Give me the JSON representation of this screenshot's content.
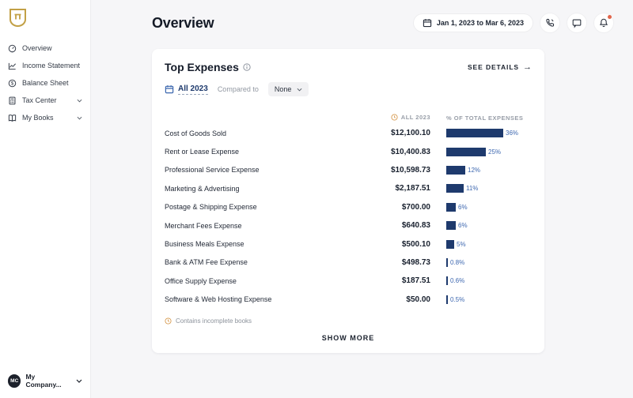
{
  "sidebar": {
    "items": [
      {
        "label": "Overview",
        "icon": "gauge-icon",
        "expandable": false
      },
      {
        "label": "Income Statement",
        "icon": "line-chart-icon",
        "expandable": false
      },
      {
        "label": "Balance Sheet",
        "icon": "dollar-circle-icon",
        "expandable": false
      },
      {
        "label": "Tax Center",
        "icon": "calculator-icon",
        "expandable": true
      },
      {
        "label": "My Books",
        "icon": "book-icon",
        "expandable": true
      }
    ],
    "company": {
      "initials": "MC",
      "name": "My Company..."
    }
  },
  "header": {
    "title": "Overview",
    "date_range": "Jan 1, 2023 to Mar 6, 2023"
  },
  "card": {
    "title": "Top Expenses",
    "see_details_label": "SEE DETAILS",
    "see_details_arrow": "→",
    "period_tab": "All 2023",
    "compared_to_label": "Compared to",
    "compare_value": "None",
    "columns": {
      "amount": "ALL 2023",
      "pct": "% OF TOTAL EXPENSES"
    },
    "rows": [
      {
        "label": "Cost of Goods Sold",
        "amount": "$12,100.10",
        "pct": 36,
        "pct_label": "36%"
      },
      {
        "label": "Rent or Lease Expense",
        "amount": "$10,400.83",
        "pct": 25,
        "pct_label": "25%"
      },
      {
        "label": "Professional Service Expense",
        "amount": "$10,598.73",
        "pct": 12,
        "pct_label": "12%"
      },
      {
        "label": "Marketing & Advertising",
        "amount": "$2,187.51",
        "pct": 11,
        "pct_label": "11%"
      },
      {
        "label": "Postage & Shipping Expense",
        "amount": "$700.00",
        "pct": 6,
        "pct_label": "6%"
      },
      {
        "label": "Merchant Fees Expense",
        "amount": "$640.83",
        "pct": 6,
        "pct_label": "6%"
      },
      {
        "label": "Business Meals Expense",
        "amount": "$500.10",
        "pct": 5,
        "pct_label": "5%"
      },
      {
        "label": "Bank & ATM Fee Expense",
        "amount": "$498.73",
        "pct": 0.8,
        "pct_label": "0.8%"
      },
      {
        "label": "Office Supply Expense",
        "amount": "$187.51",
        "pct": 0.6,
        "pct_label": "0.6%"
      },
      {
        "label": "Software & Web Hosting Expense",
        "amount": "$50.00",
        "pct": 0.5,
        "pct_label": "0.5%"
      }
    ],
    "note": "Contains incomplete books",
    "show_more_label": "SHOW MORE"
  },
  "colors": {
    "bar": "#1E3A6D",
    "pct_text": "#3E68B0",
    "brand_gold": "#C2A046",
    "warning_orange": "#D79A4F",
    "notification_dot": "#E2654B",
    "page_bg": "#F6F6F8"
  }
}
